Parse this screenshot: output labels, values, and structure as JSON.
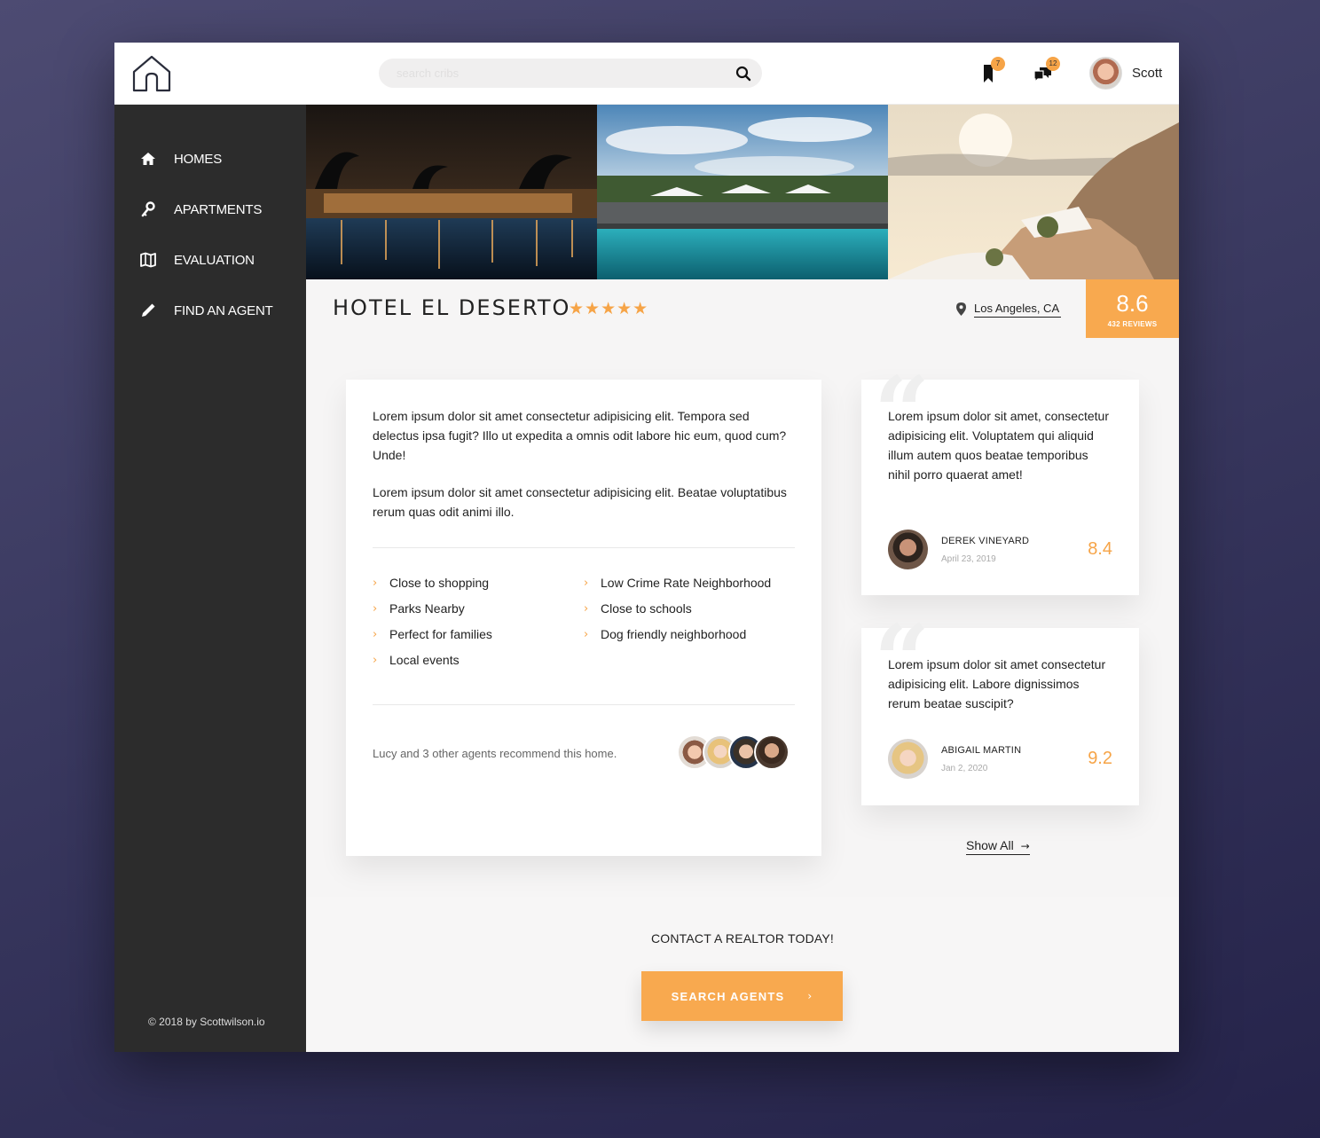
{
  "header": {
    "search_placeholder": "search cribs",
    "bookmark_count": "7",
    "message_count": "12",
    "user_name": "Scott"
  },
  "sidebar": {
    "items": [
      {
        "label": "HOMES",
        "icon": "home-icon"
      },
      {
        "label": "APARTMENTS",
        "icon": "key-icon"
      },
      {
        "label": "EVALUATION",
        "icon": "map-icon"
      },
      {
        "label": "FIND AN AGENT",
        "icon": "pencil-icon"
      }
    ],
    "copyright": "© 2018 by Scottwilson.io"
  },
  "listing": {
    "title": "HOTEL EL DESERTO",
    "stars": "★★★★★",
    "location": "Los Angeles, CA",
    "score": "8.6",
    "reviews_label": "432 REVIEWS"
  },
  "description": {
    "paragraphs": [
      "Lorem ipsum dolor sit amet consectetur adipisicing elit. Tempora sed delectus ipsa fugit? Illo ut expedita a omnis odit labore hic eum, quod cum? Unde!",
      "Lorem ipsum dolor sit amet consectetur adipisicing elit. Beatae voluptatibus rerum quas odit animi illo."
    ],
    "features_left": [
      "Close to shopping",
      "Parks Nearby",
      "Perfect for families",
      "Local events"
    ],
    "features_right": [
      "Low Crime Rate Neighborhood",
      "Close to schools",
      "Dog friendly neighborhood"
    ],
    "recommend_text": "Lucy and 3 other agents recommend this home."
  },
  "reviews": [
    {
      "text": "Lorem ipsum dolor sit amet, consectetur adipisicing elit. Voluptatem qui aliquid illum autem quos beatae temporibus nihil porro quaerat amet!",
      "name": "DEREK VINEYARD",
      "date": "April 23, 2019",
      "score": "8.4"
    },
    {
      "text": "Lorem ipsum dolor sit amet consectetur adipisicing elit. Labore dignissimos rerum beatae suscipit?",
      "name": "ABIGAIL MARTIN",
      "date": "Jan 2, 2020",
      "score": "9.2"
    }
  ],
  "show_all": "Show All",
  "cta": {
    "text": "CONTACT A REALTOR TODAY!",
    "button": "SEARCH AGENTS"
  },
  "colors": {
    "accent": "#f8a94f",
    "sidebar": "#2c2c2c"
  }
}
